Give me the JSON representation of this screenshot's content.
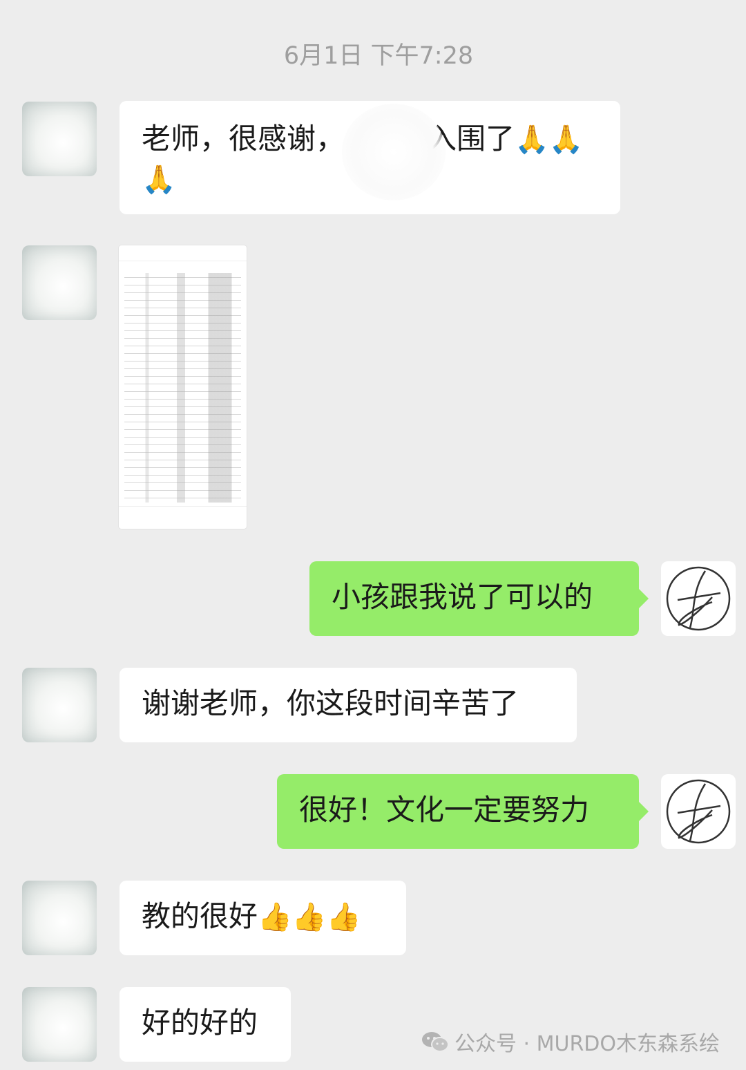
{
  "timestamp": "6月1日 下午7:28",
  "messages": [
    {
      "side": "in",
      "text_a": "老师，很感谢，",
      "text_b": "入围了",
      "emoji_row1": "🙏🙏",
      "emoji_row2": "🙏"
    },
    {
      "side": "in",
      "type": "image"
    },
    {
      "side": "out",
      "text": "小孩跟我说了可以的"
    },
    {
      "side": "in",
      "text": "谢谢老师，你这段时间辛苦了"
    },
    {
      "side": "out",
      "text": "很好！文化一定要努力"
    },
    {
      "side": "in",
      "text": "教的很好",
      "emoji": "👍👍👍"
    },
    {
      "side": "in",
      "text": "好的好的"
    }
  ],
  "watermark": {
    "icon": "wechat-icon",
    "text": "公众号 · MURDO木东森系绘"
  }
}
